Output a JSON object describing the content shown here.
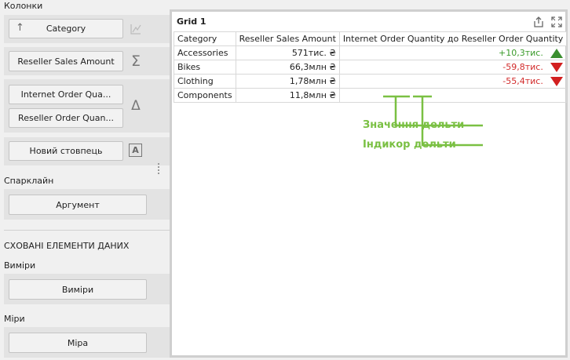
{
  "sidebar": {
    "columns_label": "Колонки",
    "buttons": {
      "category": "Category",
      "reseller_sales": "Reseller Sales Amount",
      "internet_qty": "Internet Order Qua...",
      "reseller_qty": "Reseller Order Quan...",
      "new_column": "Новий стовпець"
    },
    "sparkline_label": "Спарклайн",
    "argument_button": "Аргумент",
    "hidden_header": "СХОВАНІ ЕЛЕМЕНТИ ДАНИХ",
    "dimensions_label": "Виміри",
    "dimensions_button": "Виміри",
    "measures_label": "Міри",
    "measure_button": "Міра"
  },
  "grid": {
    "title": "Grid 1",
    "columns": [
      "Category",
      "Reseller Sales Amount",
      "Internet Order Quantity до Reseller Order Quantity"
    ],
    "rows": [
      {
        "category": "Accessories",
        "sales": "571тис. ₴",
        "delta": "+10,3тис.",
        "direction": "up"
      },
      {
        "category": "Bikes",
        "sales": "66,3млн ₴",
        "delta": "-59,8тис.",
        "direction": "down"
      },
      {
        "category": "Clothing",
        "sales": "1,78млн ₴",
        "delta": "-55,4тис.",
        "direction": "down"
      },
      {
        "category": "Components",
        "sales": "11,8млн ₴",
        "delta": "",
        "direction": ""
      }
    ]
  },
  "annotations": {
    "delta_value": "Значення дельти",
    "delta_indicator": "Індикор дельти"
  },
  "colors": {
    "positive": "#3a9a2a",
    "negative": "#d22b2b",
    "annotation": "#7ac043"
  }
}
